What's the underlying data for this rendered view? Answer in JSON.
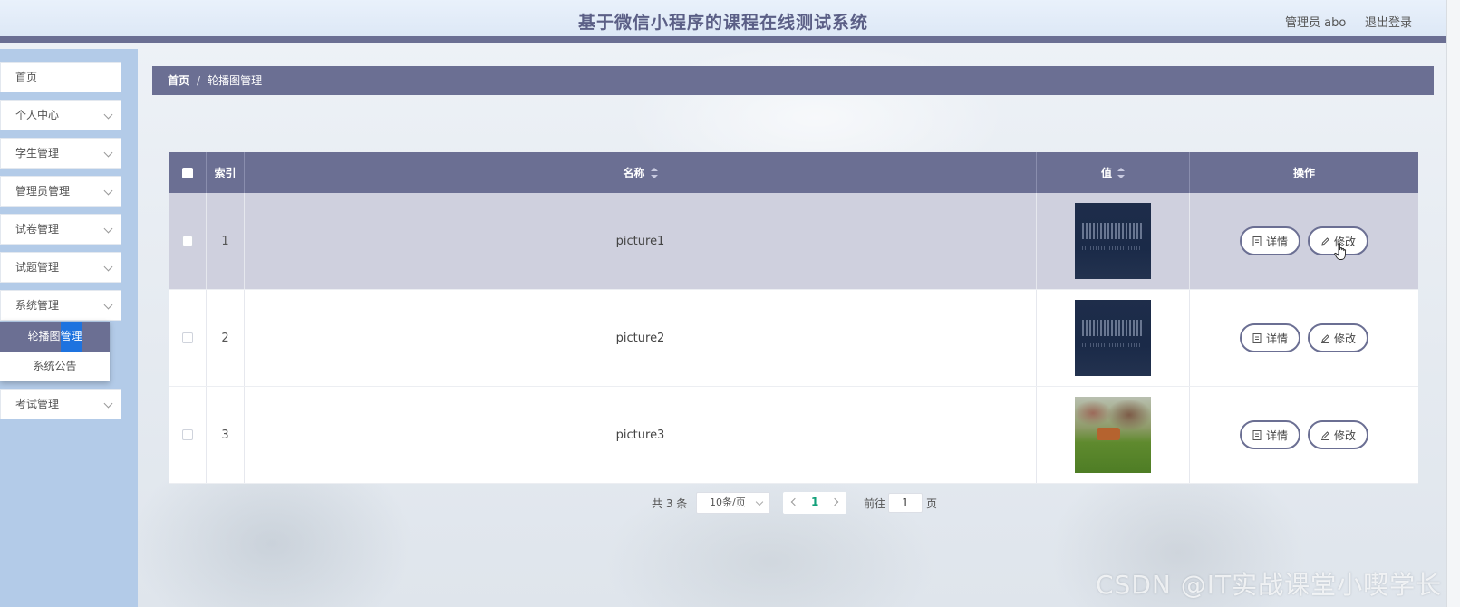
{
  "header": {
    "title": "基于微信小程序的课程在线测试系统",
    "user": "管理员 abo",
    "logout": "退出登录"
  },
  "sidebar": {
    "items": [
      {
        "label": "首页"
      },
      {
        "label": "个人中心"
      },
      {
        "label": "学生管理"
      },
      {
        "label": "管理员管理"
      },
      {
        "label": "试卷管理"
      },
      {
        "label": "试题管理"
      },
      {
        "label": "系统管理"
      },
      {
        "label": "考试管理"
      }
    ],
    "submenu": [
      {
        "label": "轮播图管理",
        "active": true
      },
      {
        "label": "系统公告",
        "active": false
      }
    ]
  },
  "breadcrumb": {
    "home": "首页",
    "separator": "/",
    "current": "轮播图管理"
  },
  "table": {
    "columns": {
      "index": "索引",
      "name": "名称",
      "value": "值",
      "actions": "操作"
    },
    "rows": [
      {
        "index": "1",
        "name": "picture1",
        "image": "dark-banner"
      },
      {
        "index": "2",
        "name": "picture2",
        "image": "dark-banner"
      },
      {
        "index": "3",
        "name": "picture3",
        "image": "park-photo"
      }
    ],
    "detail_label": "详情",
    "edit_label": "修改"
  },
  "pagination": {
    "total": "共 3 条",
    "page_size": "10条/页",
    "current_page": "1",
    "goto_label": "前往",
    "goto_value": "1",
    "page_unit": "页"
  },
  "watermark": "CSDN @IT实战课堂小喫学长",
  "colors": {
    "primary": "#6b6f93",
    "sidebar_bg": "#b3cbe8",
    "active_highlight": "#1673e8"
  }
}
